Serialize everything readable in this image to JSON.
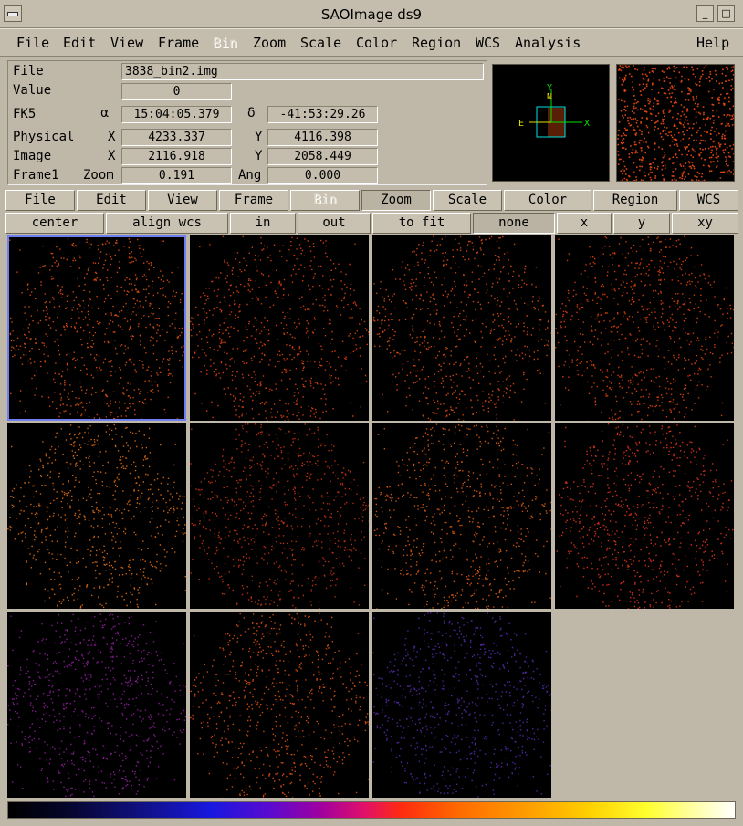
{
  "window": {
    "title": "SAOImage ds9",
    "minimize": "_",
    "maximize": "□"
  },
  "menubar": {
    "items": [
      "File",
      "Edit",
      "View",
      "Frame",
      "Bin",
      "Zoom",
      "Scale",
      "Color",
      "Region",
      "WCS",
      "Analysis"
    ],
    "disabled": [
      "Bin"
    ],
    "help": "Help"
  },
  "info": {
    "file": {
      "label": "File",
      "value": "3838_bin2.img"
    },
    "value": {
      "label": "Value",
      "value": "0"
    },
    "fk5": {
      "label": "FK5",
      "alpha_sym": "α",
      "alpha": "15:04:05.379",
      "delta_sym": "δ",
      "delta": "-41:53:29.26"
    },
    "physical": {
      "label": "Physical",
      "x_label": "X",
      "x": "4233.337",
      "y_label": "Y",
      "y": "4116.398"
    },
    "image": {
      "label": "Image",
      "x_label": "X",
      "x": "2116.918",
      "y_label": "Y",
      "y": "2058.449"
    },
    "frame": {
      "label": "Frame1",
      "zoom_label": "Zoom",
      "zoom": "0.191",
      "ang_label": "Ang",
      "ang": "0.000"
    }
  },
  "panner": {
    "n": "N",
    "e": "E",
    "x": "X",
    "y": "Y"
  },
  "buttonbar": {
    "items": [
      "File",
      "Edit",
      "View",
      "Frame",
      "Bin",
      "Zoom",
      "Scale",
      "Color",
      "Region",
      "WCS"
    ],
    "active": "Zoom",
    "disabled": "Bin"
  },
  "zoombar": {
    "items": [
      "center",
      "align wcs",
      "in",
      "out",
      "to fit",
      "none",
      "x",
      "y",
      "xy"
    ],
    "active": "none"
  },
  "frames": {
    "count": 11,
    "current": 1,
    "colors": [
      "#ff5a10",
      "#ff4a10",
      "#ff5512",
      "#ff4a0a",
      "#ff7a10",
      "#e03a10",
      "#ff6810",
      "#ff3a20",
      "#a020b0",
      "#ff5a10",
      "#6030c0"
    ]
  },
  "colorbar": {
    "colormap": "bb"
  }
}
